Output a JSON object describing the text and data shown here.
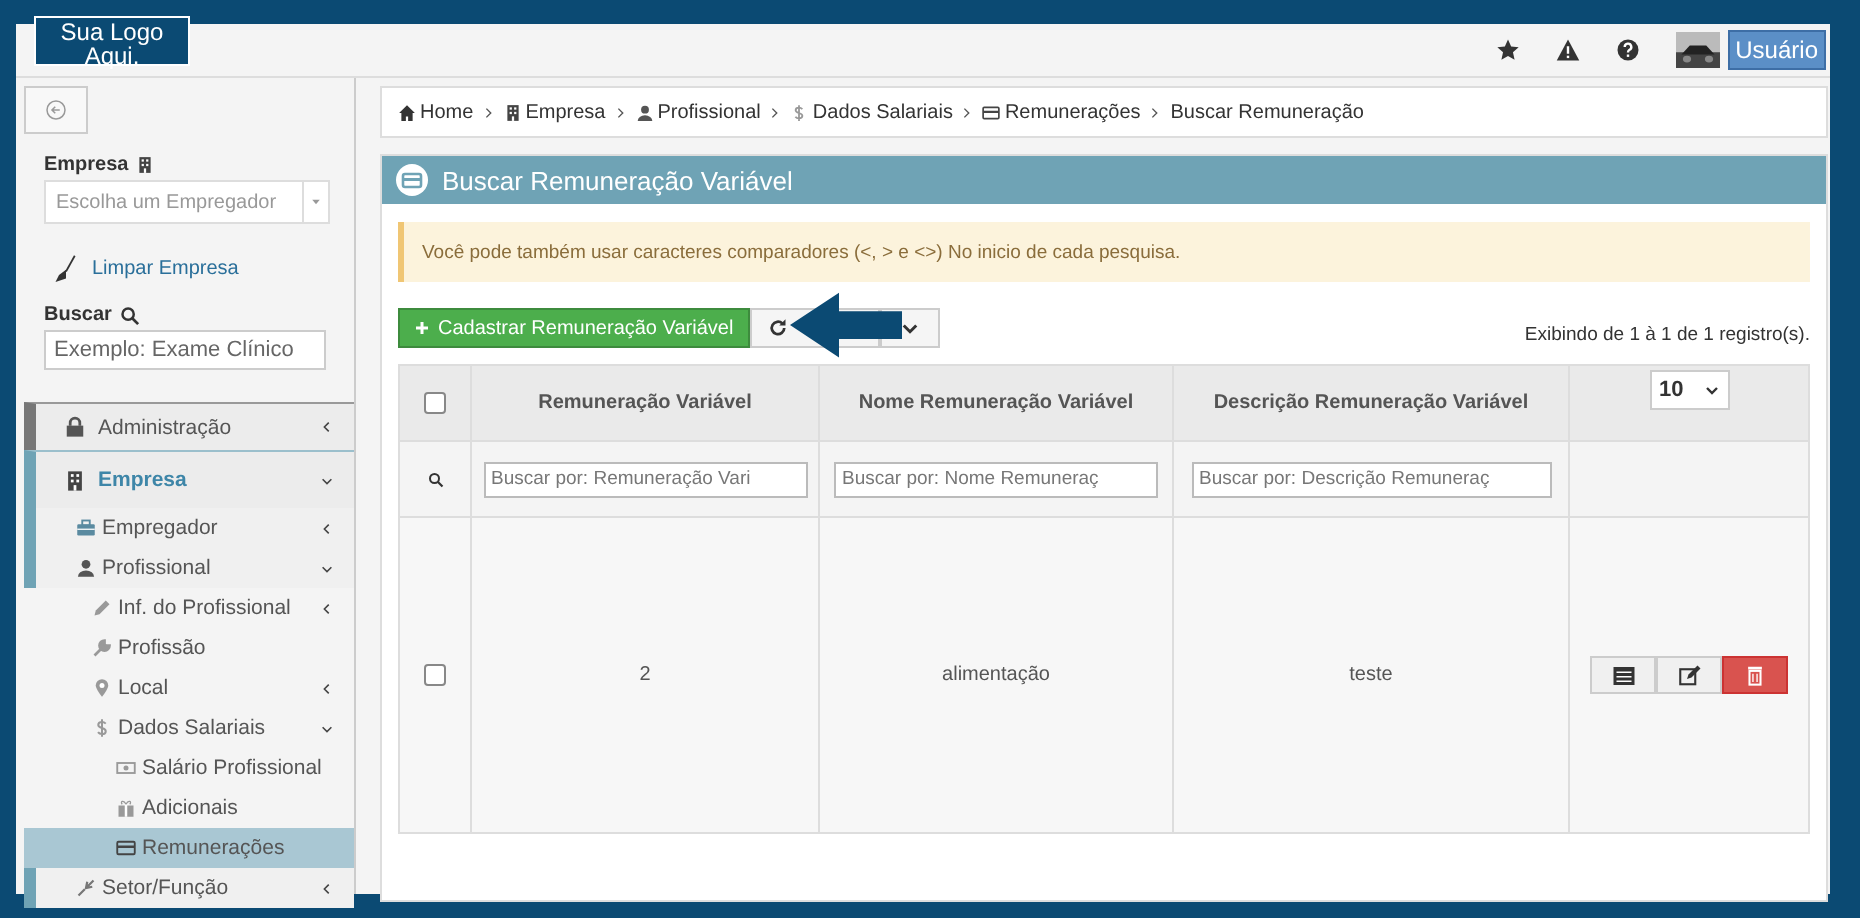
{
  "logo": "Sua Logo Aqui.",
  "topbar": {
    "user_button": "Usuário"
  },
  "sidebar": {
    "company_label": "Empresa",
    "company_select": {
      "placeholder": "Escolha um Empregador"
    },
    "clear_link": "Limpar Empresa",
    "search_label": "Buscar",
    "search": {
      "placeholder": "Exemplo: Exame Clínico"
    },
    "menu": [
      {
        "label": "Administração",
        "expanded": false,
        "selected": false
      },
      {
        "label": "Empresa",
        "expanded": true,
        "selected": false,
        "children": [
          {
            "label": "Empregador",
            "expanded": false,
            "selected": false
          },
          {
            "label": "Profissional",
            "expanded": true,
            "selected": false,
            "children": [
              {
                "label": "Inf. do Profissional",
                "expanded": false,
                "selected": false
              },
              {
                "label": "Profissão",
                "selected": false
              },
              {
                "label": "Local",
                "expanded": false,
                "selected": false
              },
              {
                "label": "Dados Salariais",
                "expanded": true,
                "selected": false,
                "children": [
                  {
                    "label": "Salário Profissional",
                    "selected": false
                  },
                  {
                    "label": "Adicionais",
                    "selected": false
                  },
                  {
                    "label": "Remunerações",
                    "selected": true
                  }
                ]
              }
            ]
          },
          {
            "label": "Setor/Função",
            "expanded": false,
            "selected": false
          }
        ]
      }
    ]
  },
  "breadcrumb": [
    "Home",
    "Empresa",
    "Profissional",
    "Dados Salariais",
    "Remunerações",
    "Buscar Remuneração"
  ],
  "panel": {
    "title": "Buscar Remuneração Variável",
    "alert": "Você pode também usar caracteres comparadores (<, > e <>) No inicio de cada pesquisa.",
    "add_button": "Cadastrar Remuneração Variável",
    "record_info": "Exibindo de 1 à 1 de 1 registro(s).",
    "page_size": "10",
    "table": {
      "select_all_checked": false,
      "columns": [
        "Remuneração Variável",
        "Nome Remuneração Variável",
        "Descrição Remuneração Variável"
      ],
      "filters": [
        {
          "placeholder": "Buscar por: Remuneração Vari"
        },
        {
          "placeholder": "Buscar por: Nome Remuneraç"
        },
        {
          "placeholder": "Buscar por: Descrição Remuneraç"
        }
      ],
      "rows": [
        {
          "checked": false,
          "cells": [
            "2",
            "alimentação",
            "teste"
          ]
        }
      ]
    }
  }
}
